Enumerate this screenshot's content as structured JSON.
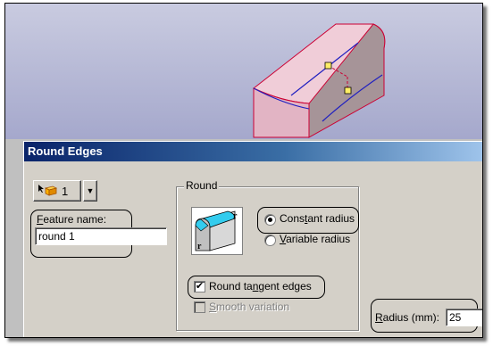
{
  "dialog": {
    "title": "Round Edges",
    "selector": {
      "value": "1",
      "icon": "edge-select-icon"
    },
    "feature_name": {
      "label_hotkey": "F",
      "label_rest": "eature name:",
      "value": "round 1"
    },
    "round_group": {
      "legend": "Round",
      "illustration_icon": "round-edge-illustration-icon",
      "constant_radius": {
        "pre": "Cons",
        "hotkey": "t",
        "post": "ant radius",
        "selected": true
      },
      "variable_radius": {
        "hotkey": "V",
        "post": "ariable radius",
        "selected": false
      },
      "round_tangent_edges": {
        "pre": "Round ta",
        "hotkey": "n",
        "post": "gent edges",
        "checked": true
      },
      "smooth_variation": {
        "hotkey": "S",
        "post": "mooth variation",
        "checked": false,
        "enabled": false
      }
    },
    "radius": {
      "label_hotkey": "R",
      "label_rest": "adius (mm):",
      "value": "25"
    }
  },
  "colors": {
    "title_gradient_start": "#0a246a",
    "viewport_background": "#b4b7d6",
    "model_face": "#e6b8c8",
    "model_edge": "#cc0033",
    "selected_edge": "#2020c0",
    "round_illustration": "#33ccee"
  }
}
